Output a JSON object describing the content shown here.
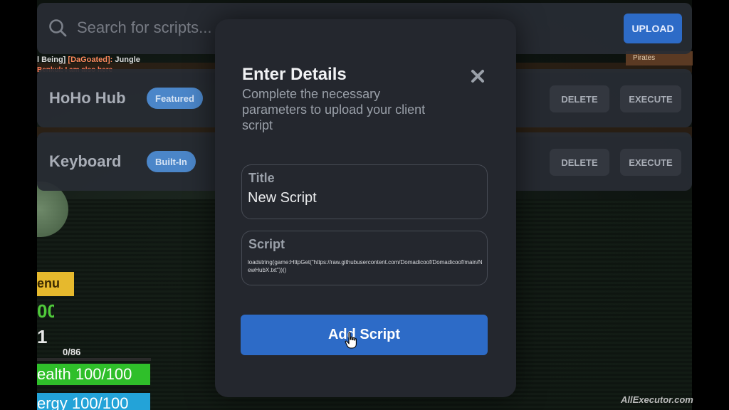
{
  "background": {
    "chat": {
      "line1_prefix": "l Being]",
      "line1_tag": "[DaGoated]:",
      "line1_text": "Jungle",
      "line2_text": "Benkul: I am also here"
    },
    "hud": {
      "menu_label": "enu",
      "stat1": "00",
      "stat2": "1",
      "xp": "0/86",
      "health": "ealth 100/100",
      "energy": "ergy 100/100"
    },
    "pirates_label": "Pirates",
    "watermark": "AllExecutor.com"
  },
  "topbar": {
    "search_placeholder": "Search for scripts...",
    "upload_label": "UPLOAD"
  },
  "scripts": [
    {
      "name": "HoHo Hub",
      "badge": "Featured",
      "delete_label": "DELETE",
      "execute_label": "EXECUTE"
    },
    {
      "name": "Keyboard",
      "badge": "Built-In",
      "delete_label": "DELETE",
      "execute_label": "EXECUTE"
    }
  ],
  "modal": {
    "title": "Enter Details",
    "subtitle": "Complete the necessary parameters to upload your client script",
    "title_field": {
      "label": "Title",
      "value": "New Script"
    },
    "script_field": {
      "label": "Script",
      "value": "loadstring(game:HttpGet(\"https://raw.githubusercontent.com/Domadicoof/Domadicoof/main/NewHubX.txt\"))()"
    },
    "submit_label": "Add Script"
  },
  "colors": {
    "accent": "#2d6bc7",
    "panel": "#24272e",
    "badge": "#4b86c9"
  }
}
